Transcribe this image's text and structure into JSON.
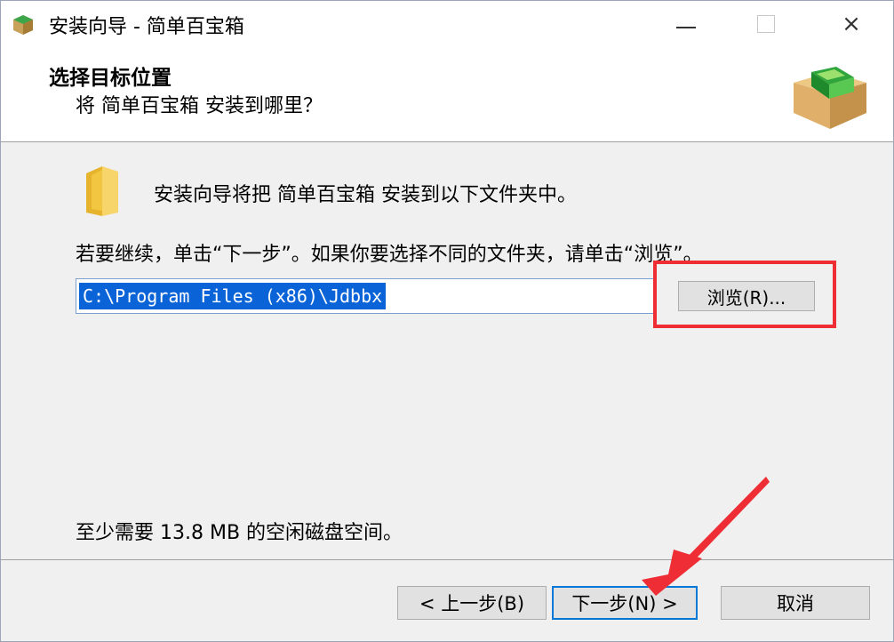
{
  "window": {
    "title": "安装向导 - 简单百宝箱",
    "controls": {
      "minimize": "minimize-icon",
      "maximize": "maximize-icon",
      "close": "×"
    }
  },
  "header": {
    "title": "选择目标位置",
    "subtitle": "将 简单百宝箱 安装到哪里？"
  },
  "main": {
    "intro": "安装向导将把 简单百宝箱 安装到以下文件夹中。",
    "instruction": "若要继续，单击“下一步”。如果你要选择不同的文件夹，请单击“浏览”。",
    "path_value": "C:\\Program Files (x86)\\Jdbbx",
    "browse_label": "浏览(R)...",
    "disk_space": "至少需要 13.8 MB 的空闲磁盘空间。"
  },
  "footer": {
    "back_label": "< 上一步(B)",
    "next_label": "下一步(N) >",
    "cancel_label": "取消"
  },
  "colors": {
    "annotation": "#ef2d35",
    "selection": "#0a64d8",
    "focus_border": "#0078d7"
  },
  "icons": [
    "app-icon",
    "box-icon",
    "folder-icon"
  ]
}
